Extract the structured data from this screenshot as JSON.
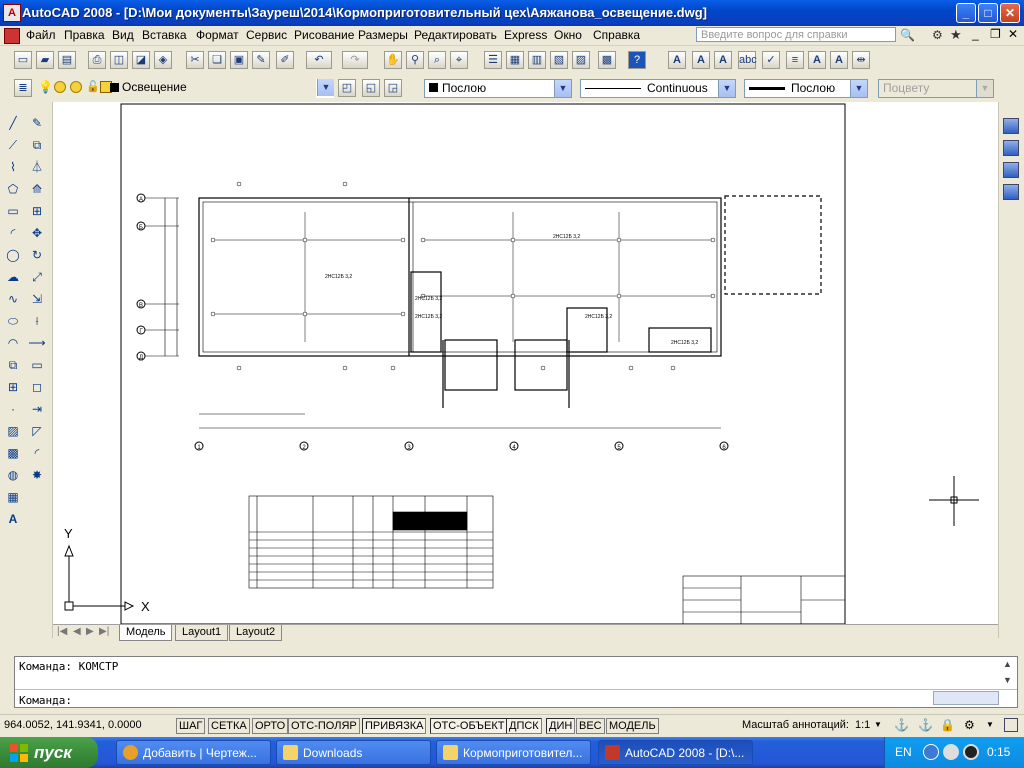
{
  "window": {
    "app_icon_glyph": "A",
    "title": "AutoCAD 2008 - [D:\\Мои документы\\Зауреш\\2014\\Кормоприготовительный цех\\Аяжанова_освещение.dwg]",
    "minimize": "_",
    "maximize": "□",
    "close": "✕"
  },
  "menu": {
    "items": [
      "Файл",
      "Правка",
      "Вид",
      "Вставка",
      "Формат",
      "Сервис",
      "Рисование",
      "Размеры",
      "Редактировать",
      "Express",
      "Окно",
      "Справка"
    ],
    "help_placeholder": "Введите вопрос для справки"
  },
  "layers": {
    "current_layer": "Освещение",
    "color": "Послою",
    "linetype": "Continuous",
    "lineweight": "Послою",
    "plotstyle": "Поцвету"
  },
  "drawing": {
    "grid_axes_bottom": [
      "1",
      "2",
      "3",
      "4",
      "5",
      "6"
    ],
    "grid_axes_left": [
      "А",
      "Б",
      "В",
      "Г",
      "Д"
    ],
    "room_labels": [
      "2НС12Б 3,2",
      "2НС12Б 3,2",
      "2НС12Б 3,2",
      "2НС12Б 3,2",
      "2НС12Б 3,2",
      "2НС12Б 3,2"
    ],
    "ucs_x": "X",
    "ucs_y": "Y"
  },
  "layout_tabs": [
    "Модель",
    "Layout1",
    "Layout2"
  ],
  "layout_active": "Модель",
  "command": {
    "line1": "Команда: КОМСТР",
    "prompt": "Команда:"
  },
  "status": {
    "coords": "964.0052, 141.9341, 0.0000",
    "buttons": [
      "ШАГ",
      "СЕТКА",
      "ОРТО",
      "ОТС-ПОЛЯР",
      "ПРИВЯЗКА",
      "ОТС-ОБЪЕКТ",
      "ДПСК",
      "ДИН",
      "ВЕС",
      "МОДЕЛЬ"
    ],
    "annotation_scale_label": "Масштаб аннотаций:",
    "annotation_scale_value": "1:1"
  },
  "taskbar": {
    "start": "пуск",
    "tasks": [
      {
        "label": "Добавить | Чертеж...",
        "active": false,
        "icon_color": "#e7a02a"
      },
      {
        "label": "Downloads",
        "active": false,
        "icon_color": "#f5d36b"
      },
      {
        "label": "Кормоприготовител...",
        "active": false,
        "icon_color": "#f5d36b"
      },
      {
        "label": "AutoCAD 2008 - [D:\\...",
        "active": true,
        "icon_color": "#c0392b"
      }
    ],
    "lang": "EN",
    "clock": "0:15"
  }
}
